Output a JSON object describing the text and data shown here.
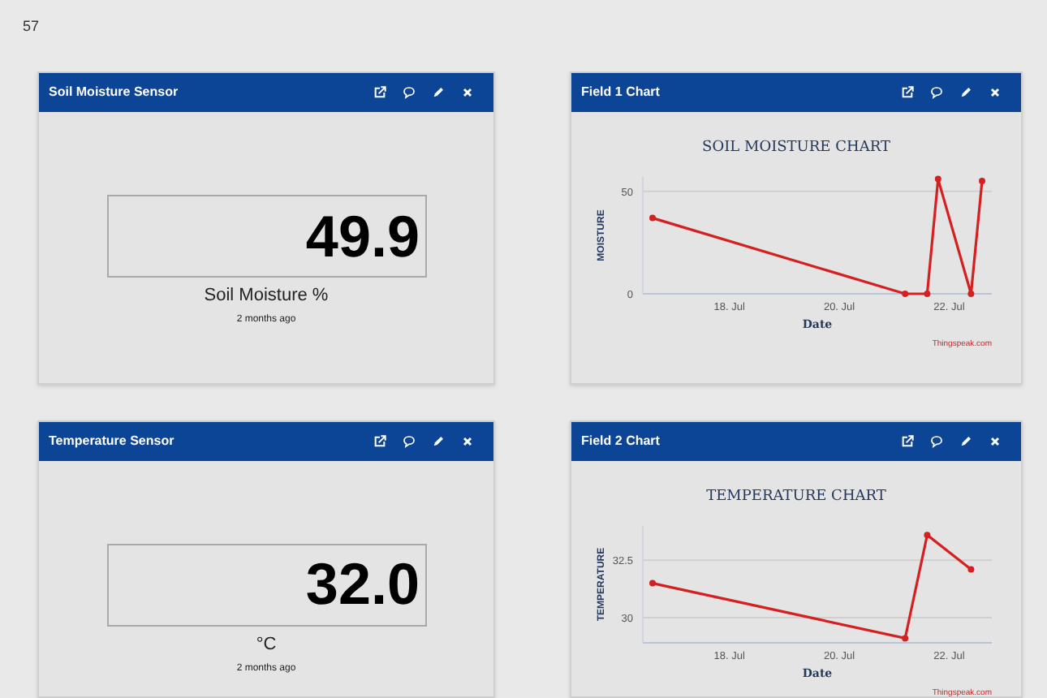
{
  "page_header": {
    "text": "57"
  },
  "widgets": [
    {
      "kind": "numeric",
      "title": "Soil Moisture Sensor",
      "value": "49.9",
      "unit": "Soil Moisture %",
      "updated": "2 months ago"
    },
    {
      "kind": "chart",
      "title": "Field 1 Chart",
      "credit": "Thingspeak.com",
      "chart_data": {
        "type": "line",
        "title": "SOIL MOISTURE CHART",
        "xlabel": "Date",
        "ylabel": "MOISTURE",
        "ylim": [
          0,
          57
        ],
        "yticks": [
          0,
          50
        ],
        "categories": [
          null,
          null,
          null,
          null,
          null,
          null,
          null,
          "18. Jul",
          null,
          null,
          null,
          null,
          null,
          null,
          null,
          null,
          null,
          "20. Jul",
          null,
          null,
          null,
          null,
          null,
          null,
          null,
          null,
          null,
          "22. Jul",
          null,
          null,
          null
        ],
        "series": [
          {
            "color": "#d42020",
            "marker": "circle",
            "values": [
              37,
              null,
              null,
              null,
              null,
              null,
              null,
              null,
              null,
              null,
              null,
              null,
              null,
              null,
              null,
              null,
              null,
              null,
              null,
              null,
              null,
              null,
              null,
              0,
              null,
              0,
              56,
              null,
              null,
              0,
              55
            ]
          }
        ]
      }
    },
    {
      "kind": "numeric",
      "title": "Temperature Sensor",
      "value": "32.0",
      "unit": "°C",
      "updated": "2 months ago"
    },
    {
      "kind": "chart",
      "title": "Field 2 Chart",
      "credit": "Thingspeak.com",
      "chart_data": {
        "type": "line",
        "title": "TEMPERATURE CHART",
        "xlabel": "Date",
        "ylabel": "TEMPERATURE",
        "ylim": [
          28.9,
          34
        ],
        "yticks": [
          30,
          32.5
        ],
        "categories": [
          null,
          null,
          null,
          null,
          null,
          null,
          null,
          "18. Jul",
          null,
          null,
          null,
          null,
          null,
          null,
          null,
          null,
          null,
          "20. Jul",
          null,
          null,
          null,
          null,
          null,
          null,
          null,
          null,
          null,
          "22. Jul",
          null,
          null,
          null
        ],
        "series": [
          {
            "color": "#d42020",
            "marker": "circle",
            "values": [
              31.5,
              null,
              null,
              null,
              null,
              null,
              null,
              null,
              null,
              null,
              null,
              null,
              null,
              null,
              null,
              null,
              null,
              null,
              null,
              null,
              null,
              null,
              null,
              29.1,
              null,
              33.6,
              null,
              null,
              null,
              32.1,
              null
            ]
          }
        ]
      }
    }
  ]
}
